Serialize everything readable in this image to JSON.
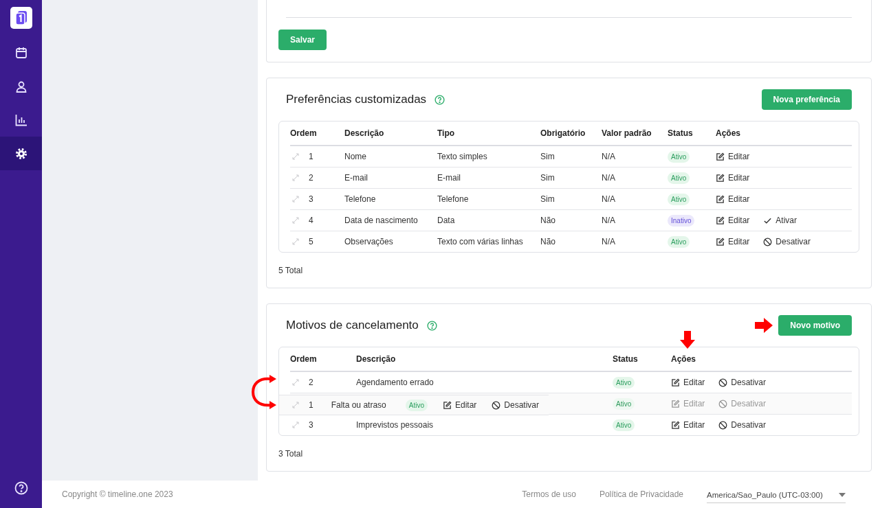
{
  "sidebar": {
    "items": [
      {
        "selected": false
      },
      {
        "selected": false
      },
      {
        "selected": false
      },
      {
        "selected": true
      }
    ]
  },
  "settings_card": {
    "save_button": "Salvar"
  },
  "preferences": {
    "title": "Preferências customizadas",
    "new_button": "Nova preferência",
    "columns": [
      "Ordem",
      "Descrição",
      "Tipo",
      "Obrigatório",
      "Valor padrão",
      "Status",
      "Ações"
    ],
    "rows": [
      {
        "order": "1",
        "description": "Nome",
        "type": "Texto simples",
        "required": "Sim",
        "default": "N/A",
        "status": {
          "label": "Ativo",
          "active": true
        },
        "actions": [
          {
            "kind": "edit",
            "label": "Editar"
          }
        ]
      },
      {
        "order": "2",
        "description": "E-mail",
        "type": "E-mail",
        "required": "Sim",
        "default": "N/A",
        "status": {
          "label": "Ativo",
          "active": true
        },
        "actions": [
          {
            "kind": "edit",
            "label": "Editar"
          }
        ]
      },
      {
        "order": "3",
        "description": "Telefone",
        "type": "Telefone",
        "required": "Sim",
        "default": "N/A",
        "status": {
          "label": "Ativo",
          "active": true
        },
        "actions": [
          {
            "kind": "edit",
            "label": "Editar"
          }
        ]
      },
      {
        "order": "4",
        "description": "Data de nascimento",
        "type": "Data",
        "required": "Não",
        "default": "N/A",
        "status": {
          "label": "Inativo",
          "active": false
        },
        "actions": [
          {
            "kind": "edit",
            "label": "Editar"
          },
          {
            "kind": "activate",
            "label": "Ativar"
          }
        ]
      },
      {
        "order": "5",
        "description": "Observações",
        "type": "Texto com várias linhas",
        "required": "Não",
        "default": "N/A",
        "status": {
          "label": "Ativo",
          "active": true
        },
        "actions": [
          {
            "kind": "edit",
            "label": "Editar"
          },
          {
            "kind": "deactivate",
            "label": "Desativar"
          }
        ]
      }
    ],
    "total": "5 Total"
  },
  "cancel_reasons": {
    "title": "Motivos de cancelamento",
    "new_button": "Novo motivo",
    "columns": [
      "Ordem",
      "Descrição",
      "Status",
      "Ações"
    ],
    "rows": [
      {
        "kind": "row",
        "order": "2",
        "description": "Agendamento errado",
        "status": {
          "label": "Ativo",
          "active": true
        },
        "actions": [
          {
            "kind": "edit",
            "label": "Editar"
          },
          {
            "kind": "deactivate",
            "label": "Desativar"
          }
        ]
      },
      {
        "kind": "ghost",
        "status": {
          "label": "Ativo",
          "active": true
        },
        "actions": [
          {
            "kind": "edit",
            "label": "Editar"
          },
          {
            "kind": "deactivate",
            "label": "Desativar"
          }
        ],
        "dragged": {
          "order": "1",
          "description": "Falta ou atraso",
          "status": {
            "label": "Ativo",
            "active": true
          },
          "actions": [
            {
              "kind": "edit",
              "label": "Editar"
            },
            {
              "kind": "deactivate",
              "label": "Desativar"
            }
          ]
        }
      },
      {
        "kind": "row",
        "order": "3",
        "description": "Imprevistos pessoais",
        "status": {
          "label": "Ativo",
          "active": true
        },
        "actions": [
          {
            "kind": "edit",
            "label": "Editar"
          },
          {
            "kind": "deactivate",
            "label": "Desativar"
          }
        ]
      }
    ],
    "total": "3 Total"
  },
  "footer": {
    "copyright": "Copyright © timeline.one 2023",
    "links": [
      "Termos de uso",
      "Política de Privacidade"
    ],
    "timezone": "America/Sao_Paulo (UTC-03:00)"
  }
}
